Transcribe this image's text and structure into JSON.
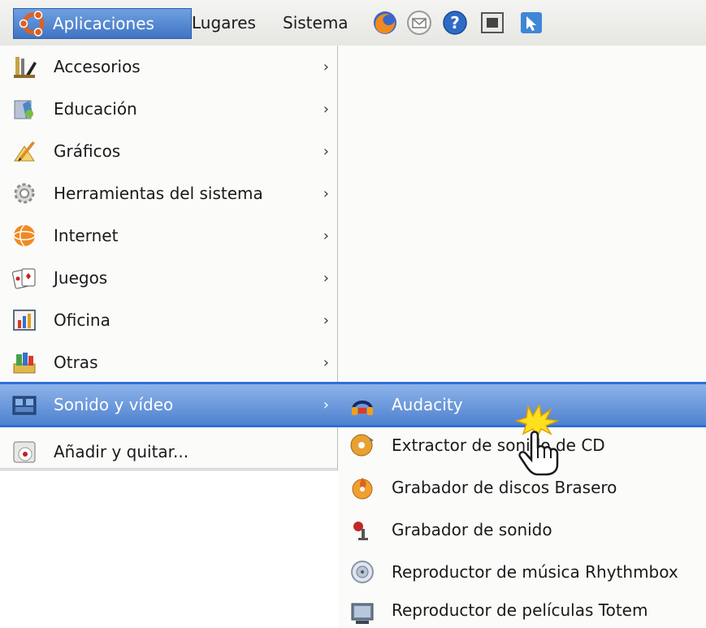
{
  "panel": {
    "menus": [
      "Aplicaciones",
      "Lugares",
      "Sistema"
    ],
    "launchers": [
      "firefox-icon",
      "mail-icon",
      "help-icon",
      "screenshot-icon",
      "cursor-app-icon"
    ]
  },
  "menu": {
    "categories": [
      {
        "label": "Accesorios",
        "icon": "accessories-icon"
      },
      {
        "label": "Educación",
        "icon": "education-icon"
      },
      {
        "label": "Gráficos",
        "icon": "graphics-icon"
      },
      {
        "label": "Herramientas del sistema",
        "icon": "system-tools-icon"
      },
      {
        "label": "Internet",
        "icon": "internet-icon"
      },
      {
        "label": "Juegos",
        "icon": "games-icon"
      },
      {
        "label": "Oficina",
        "icon": "office-icon"
      },
      {
        "label": "Otras",
        "icon": "other-icon"
      },
      {
        "label": "Sonido y vídeo",
        "icon": "sound-video-icon"
      }
    ],
    "add_remove": "Añadir y quitar...",
    "arrow": "›"
  },
  "submenu": {
    "items": [
      {
        "label": "Audacity",
        "icon": "audacity-icon"
      },
      {
        "label": "Extractor de sonido de CD",
        "icon": "cd-extractor-icon"
      },
      {
        "label": "Grabador de discos Brasero",
        "icon": "brasero-icon"
      },
      {
        "label": "Grabador de sonido",
        "icon": "microphone-icon"
      },
      {
        "label": "Reproductor de música Rhythmbox",
        "icon": "rhythmbox-icon"
      },
      {
        "label": "Reproductor de películas Totem",
        "icon": "totem-icon"
      }
    ]
  },
  "colors": {
    "highlight": "#4f82cf",
    "menu_bg": "#fbfbfa"
  }
}
